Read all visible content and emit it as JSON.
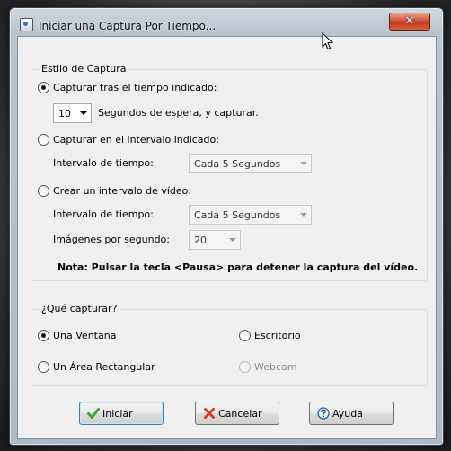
{
  "window": {
    "title": "Iniciar una Captura Por Tiempo...",
    "close_symbol": "✕"
  },
  "capture_style": {
    "legend": "Estilo de Captura",
    "opt_delay": {
      "label": "Capturar tras el tiempo indicado:",
      "checked": true
    },
    "delay_value": "10",
    "delay_suffix": "Segundos de espera, y capturar.",
    "opt_interval": {
      "label": "Capturar en el intervalo indicado:",
      "checked": false
    },
    "interval_label": "Intervalo de tiempo:",
    "interval_value": "Cada 5 Segundos",
    "opt_video": {
      "label": "Crear un intervalo de vídeo:",
      "checked": false
    },
    "video_interval_label": "Intervalo de tiempo:",
    "video_interval_value": "Cada 5 Segundos",
    "fps_label": "Imágenes por segundo:",
    "fps_value": "20",
    "note": "Nota: Pulsar la tecla <Pausa> para detener la captura del vídeo."
  },
  "what_capture": {
    "legend": "¿Qué capturar?",
    "opt_window": {
      "label": "Una Ventana",
      "checked": true
    },
    "opt_desktop": {
      "label": "Escritorio",
      "checked": false
    },
    "opt_region": {
      "label": "Un Área Rectangular",
      "checked": false
    },
    "opt_webcam": {
      "label": "Webcam",
      "checked": false,
      "disabled": true
    }
  },
  "buttons": {
    "start": "Iniciar",
    "cancel": "Cancelar",
    "help": "Ayuda"
  },
  "colors": {
    "check_green": "#3aa63a",
    "cancel_red": "#d23b2e",
    "help_blue": "#2f5f9e"
  }
}
